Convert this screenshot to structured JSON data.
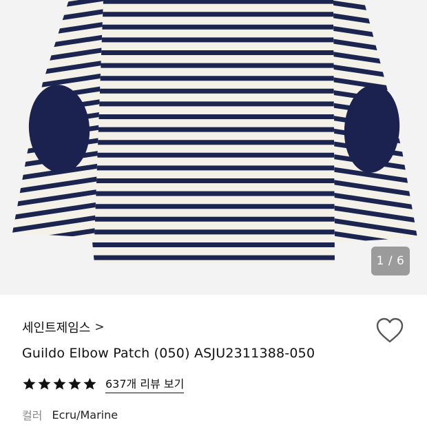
{
  "gallery": {
    "counter_current": "1",
    "counter_sep": " / ",
    "counter_total": "6",
    "colors": {
      "background": "#f3f3f3",
      "stripe_navy": "#1c2550",
      "stripe_ecru": "#f4f1e8",
      "patch_navy": "#1b2250"
    }
  },
  "product": {
    "brand": "세인트제임스",
    "brand_chevron": ">",
    "title": "Guildo Elbow Patch (050) ASJU2311388-050",
    "rating_stars": 5,
    "review_link": "637개 리뷰 보기",
    "option_label": "컬러",
    "option_value": "Ecru/Marine",
    "wishlist_icon": "heart-outline-icon"
  }
}
